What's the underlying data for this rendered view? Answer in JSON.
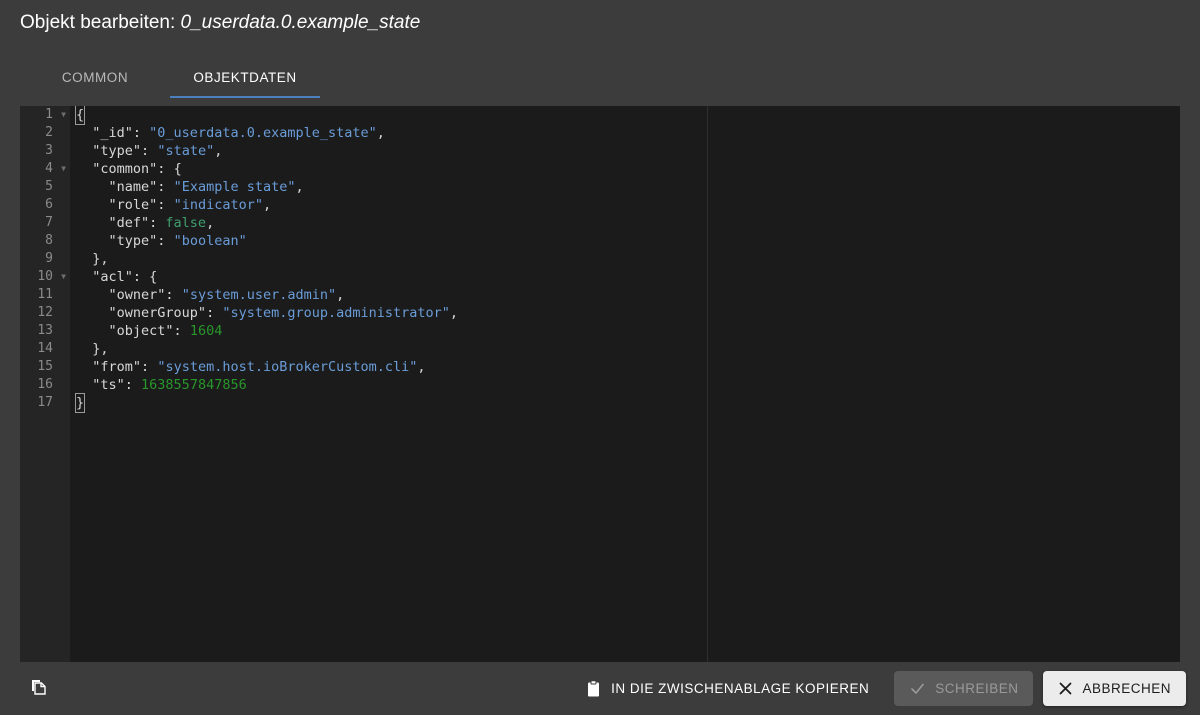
{
  "header": {
    "title_prefix": "Objekt bearbeiten:",
    "object_id": "0_userdata.0.example_state"
  },
  "tabs": [
    {
      "label": "COMMON",
      "active": false
    },
    {
      "label": "OBJEKTDATEN",
      "active": true
    }
  ],
  "editor": {
    "line_numbers": [
      "1",
      "2",
      "3",
      "4",
      "5",
      "6",
      "7",
      "8",
      "9",
      "10",
      "11",
      "12",
      "13",
      "14",
      "15",
      "16",
      "17"
    ],
    "lines": [
      "{",
      "  \"_id\": \"0_userdata.0.example_state\",",
      "  \"type\": \"state\",",
      "  \"common\": {",
      "    \"name\": \"Example state\",",
      "    \"role\": \"indicator\",",
      "    \"def\": false,",
      "    \"type\": \"boolean\"",
      "  },",
      "  \"acl\": {",
      "    \"owner\": \"system.user.admin\",",
      "    \"ownerGroup\": \"system.group.administrator\",",
      "    \"object\": 1604",
      "  },",
      "  \"from\": \"system.host.ioBrokerCustom.cli\",",
      "  \"ts\": 1638557847856",
      "}"
    ],
    "fold_lines": [
      1,
      4,
      10
    ],
    "colors": {
      "background": "#1b1b1b",
      "gutter": "#252525",
      "key": "#d7d7d7",
      "string": "#6a9cd8",
      "boolean": "#3f9e6c",
      "number": "#28962b",
      "line_number": "#8b8b8b"
    }
  },
  "footer": {
    "duplicate_icon": "copy-pages-icon",
    "copy_clipboard_label": "IN DIE ZWISCHENABLAGE KOPIEREN",
    "copy_clipboard_icon": "clipboard-icon",
    "save_label": "SCHREIBEN",
    "save_icon": "check-icon",
    "save_disabled": true,
    "cancel_label": "ABBRECHEN",
    "cancel_icon": "close-icon"
  },
  "theme": {
    "background": "#3c3c3c",
    "accent": "#4d7ebd"
  }
}
